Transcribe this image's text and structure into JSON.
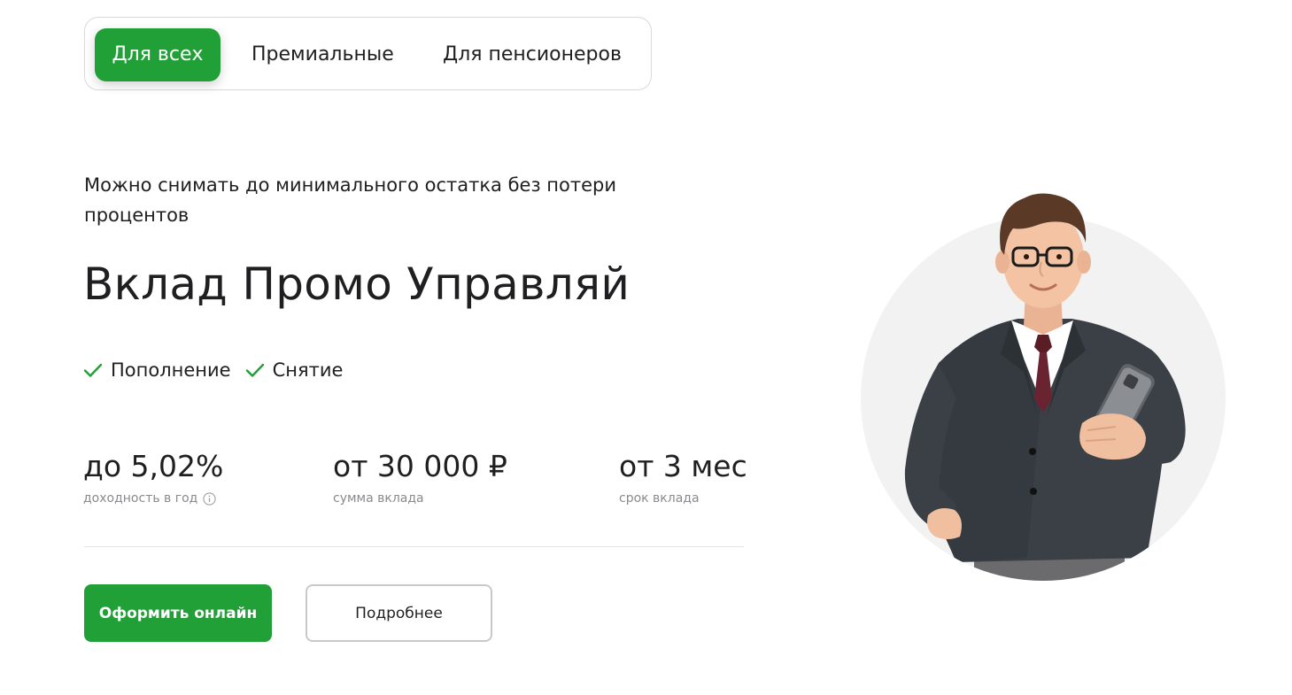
{
  "tabs": [
    {
      "label": "Для всех",
      "active": true
    },
    {
      "label": "Премиальные",
      "active": false
    },
    {
      "label": "Для пенсионеров",
      "active": false
    }
  ],
  "deposit": {
    "subtitle": "Можно снимать до минимального остатка без потери процентов",
    "title": "Вклад Промо Управляй",
    "features": [
      "Пополнение",
      "Снятие"
    ],
    "stats": [
      {
        "value": "до 5,02%",
        "label": "доходность в год",
        "info_icon": "info-icon"
      },
      {
        "value": "от 30 000 ₽",
        "label": "сумма вклада"
      },
      {
        "value": "от 3 мес",
        "label": "срок вклада"
      }
    ]
  },
  "buttons": {
    "primary": "Оформить онлайн",
    "secondary": "Подробнее"
  },
  "illustration": {
    "icon": "businessman-with-phone-illustration"
  },
  "colors": {
    "accent": "#21a038",
    "text": "#1f1f22",
    "muted": "#8a8a8e"
  }
}
